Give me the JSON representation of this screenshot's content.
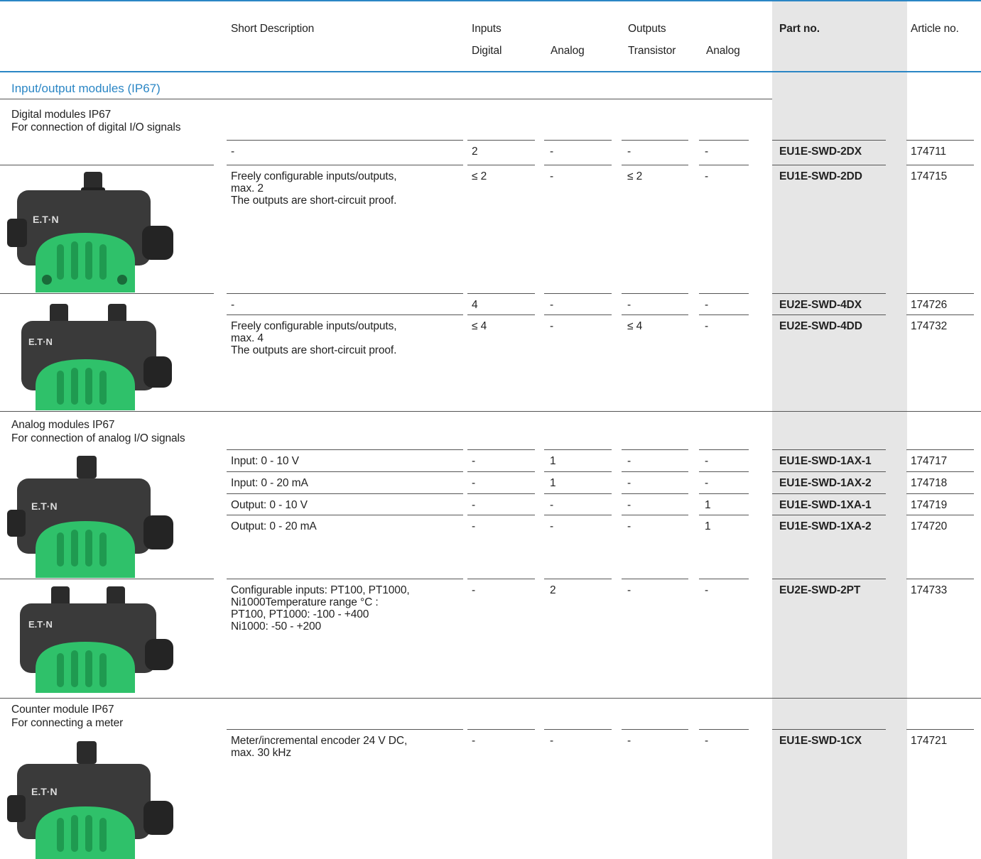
{
  "header": {
    "short_description": "Short Description",
    "inputs": "Inputs",
    "inputs_digital": "Digital",
    "inputs_analog": "Analog",
    "outputs": "Outputs",
    "outputs_transistor": "Transistor",
    "outputs_analog": "Analog",
    "part_no": "Part no.",
    "article_no": "Article no."
  },
  "section_title": "Input/output modules (IP67)",
  "groups": {
    "digital": {
      "title": "Digital modules IP67",
      "subtitle": "For connection of digital I/O signals"
    },
    "analog": {
      "title": "Analog modules IP67",
      "subtitle": "For connection of analog I/O signals"
    },
    "counter": {
      "title": "Counter module IP67",
      "subtitle": "For connecting a meter"
    }
  },
  "rows": [
    {
      "desc": "-",
      "in_digital": "2",
      "in_analog": "-",
      "out_transistor": "-",
      "out_analog": "-",
      "part": "EU1E-SWD-2DX",
      "article": "174711"
    },
    {
      "desc": "Freely configurable inputs/outputs,\nmax. 2\nThe outputs are short-circuit proof.",
      "in_digital": "≤ 2",
      "in_analog": "-",
      "out_transistor": "≤ 2",
      "out_analog": "-",
      "part": "EU1E-SWD-2DD",
      "article": "174715"
    },
    {
      "desc": "-",
      "in_digital": "4",
      "in_analog": "-",
      "out_transistor": "-",
      "out_analog": "-",
      "part": "EU2E-SWD-4DX",
      "article": "174726"
    },
    {
      "desc": "Freely configurable inputs/outputs,\nmax. 4\nThe outputs are short-circuit proof.",
      "in_digital": "≤ 4",
      "in_analog": "-",
      "out_transistor": "≤ 4",
      "out_analog": "-",
      "part": "EU2E-SWD-4DD",
      "article": "174732"
    },
    {
      "desc": "Input: 0 - 10 V",
      "in_digital": "-",
      "in_analog": "1",
      "out_transistor": "-",
      "out_analog": "-",
      "part": "EU1E-SWD-1AX-1",
      "article": "174717"
    },
    {
      "desc": "Input: 0 - 20 mA",
      "in_digital": "-",
      "in_analog": "1",
      "out_transistor": "-",
      "out_analog": "-",
      "part": "EU1E-SWD-1AX-2",
      "article": "174718"
    },
    {
      "desc": "Output: 0 - 10 V",
      "in_digital": "-",
      "in_analog": "-",
      "out_transistor": "-",
      "out_analog": "1",
      "part": "EU1E-SWD-1XA-1",
      "article": "174719"
    },
    {
      "desc": "Output: 0 - 20 mA",
      "in_digital": "-",
      "in_analog": "-",
      "out_transistor": "-",
      "out_analog": "1",
      "part": "EU1E-SWD-1XA-2",
      "article": "174720"
    },
    {
      "desc": "Configurable inputs: PT100, PT1000,\nNi1000Temperature range °C :\nPT100, PT1000: -100 - +400\nNi1000: -50 - +200",
      "in_digital": "-",
      "in_analog": "2",
      "out_transistor": "-",
      "out_analog": "-",
      "part": "EU2E-SWD-2PT",
      "article": "174733"
    },
    {
      "desc": "Meter/incremental encoder 24 V DC,\nmax. 30 kHz",
      "in_digital": "-",
      "in_analog": "-",
      "out_transistor": "-",
      "out_analog": "-",
      "part": "EU1E-SWD-1CX",
      "article": "174721"
    }
  ],
  "product_images": [
    {
      "brand_text": "E.T·N",
      "connectors": 1
    },
    {
      "brand_text": "E.T·N",
      "connectors": 2
    },
    {
      "brand_text": "E.T·N",
      "connectors": 1
    },
    {
      "brand_text": "E.T·N",
      "connectors": 2
    },
    {
      "brand_text": "E.T·N",
      "connectors": 1
    }
  ],
  "colors": {
    "accent": "#2a86c5",
    "part_column_bg": "#e6e6e6",
    "module_green": "#2fc16a",
    "module_body": "#3a3a3a"
  }
}
